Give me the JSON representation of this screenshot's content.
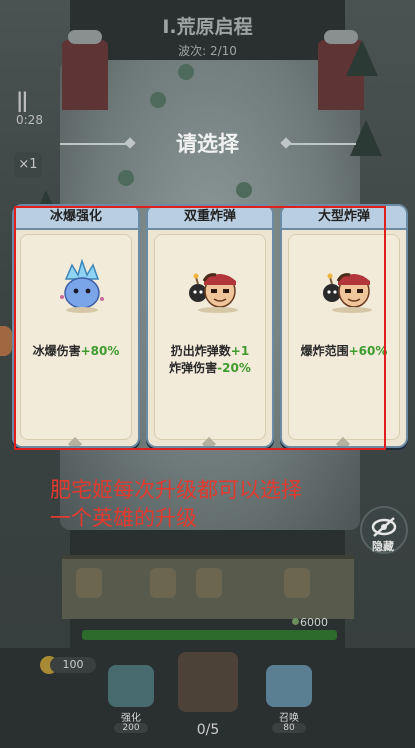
{
  "hud": {
    "level_title": "Ⅰ.荒原启程",
    "wave": "波次: 2/10",
    "timer": "0:28",
    "speed": "×1",
    "hp": "6000",
    "coins": "100",
    "strength_label": "强化",
    "strength_cost": "200",
    "summon_label": "召唤",
    "summon_cost": "80",
    "hero_count": "0/5",
    "hide_label": "隐藏"
  },
  "dialog": {
    "title": "请选择",
    "cards": [
      {
        "name": "冰爆强化",
        "desc_main": "冰爆伤害",
        "desc_bonus": "+80%",
        "icon": "ice-spirit-icon"
      },
      {
        "name": "双重炸弹",
        "line1_main": "扔出炸弹数",
        "line1_bonus": "+1",
        "line2_main": "炸弹伤害",
        "line2_bonus": "-20%",
        "icon": "bomber-hero-icon"
      },
      {
        "name": "大型炸弹",
        "desc_main": "爆炸范围",
        "desc_bonus": "+60%",
        "icon": "bomber-hero-icon"
      }
    ]
  },
  "annotation": {
    "line1": "肥宅姬每次升级都可以选择",
    "line2": "一个英雄的升级"
  },
  "colors": {
    "bonus_green": "#3f9b2e",
    "highlight_red": "#e01e1e",
    "card_header_blue": "#b9cfe1"
  }
}
